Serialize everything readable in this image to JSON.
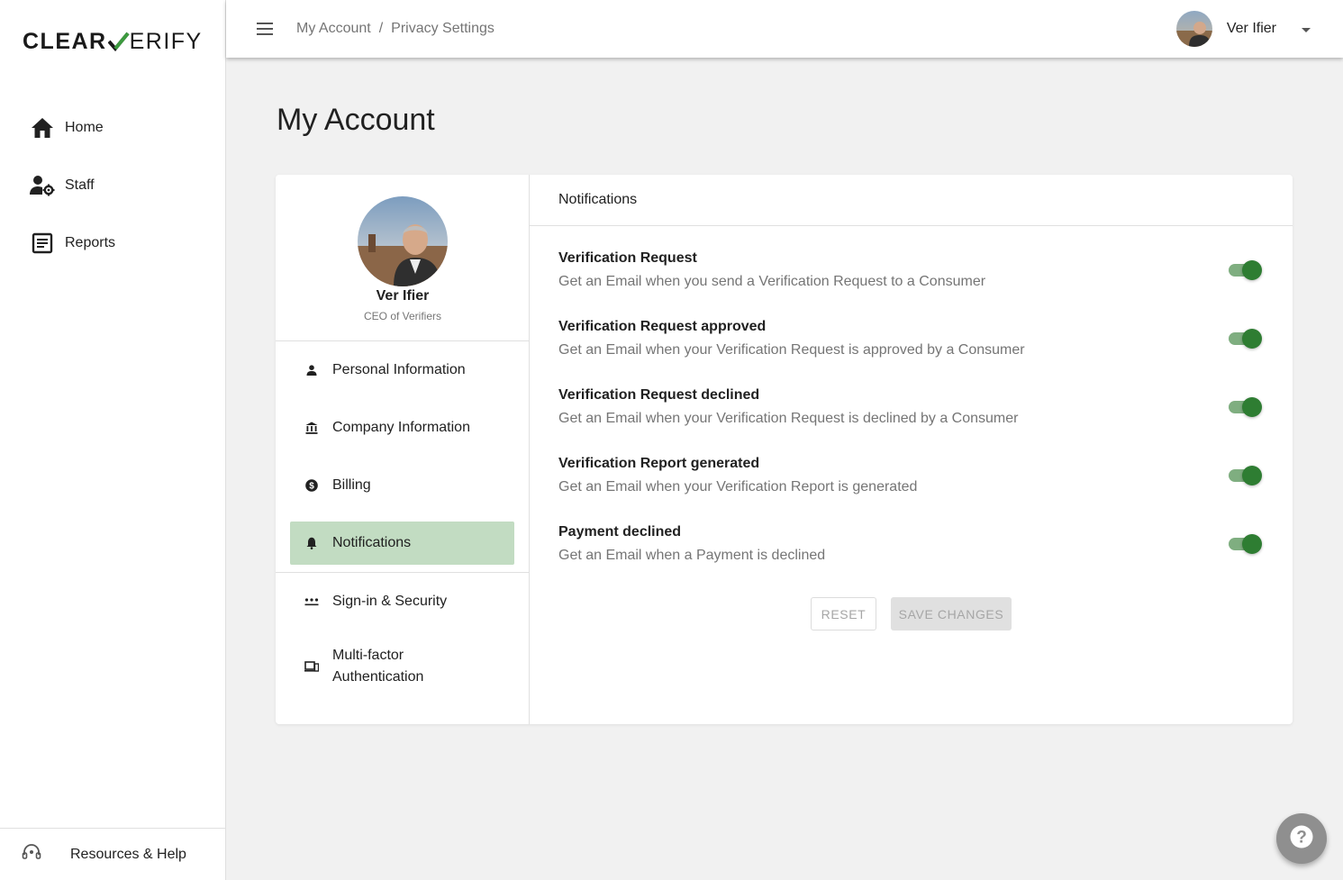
{
  "brand": {
    "part1": "CLEAR",
    "part2": "ERIFY",
    "accent": "#2e7d32"
  },
  "sidebar": {
    "items": [
      {
        "label": "Home",
        "icon": "home-icon"
      },
      {
        "label": "Staff",
        "icon": "staff-gear-icon"
      },
      {
        "label": "Reports",
        "icon": "report-icon"
      }
    ],
    "footer_label": "Resources & Help"
  },
  "header": {
    "breadcrumb": [
      "My Account",
      "Privacy Settings"
    ],
    "user_name": "Ver Ifier"
  },
  "page_title": "My Account",
  "profile": {
    "name": "Ver Ifier",
    "title": "CEO of Verifiers"
  },
  "account_nav": [
    {
      "label": "Personal Information",
      "icon": "person-icon"
    },
    {
      "label": "Company Information",
      "icon": "bank-icon"
    },
    {
      "label": "Billing",
      "icon": "dollar-icon"
    },
    {
      "label": "Notifications",
      "icon": "bell-icon",
      "active": true
    },
    {
      "label": "Sign-in & Security",
      "icon": "password-icon"
    },
    {
      "label": "Multi-factor Authentication",
      "icon": "devices-icon"
    }
  ],
  "panel": {
    "title": "Notifications",
    "items": [
      {
        "title": "Verification Request",
        "desc": "Get an Email when you send a Verification Request to a Consumer",
        "enabled": true
      },
      {
        "title": "Verification Request approved",
        "desc": "Get an Email when your Verification Request is approved by a Consumer",
        "enabled": true
      },
      {
        "title": "Verification Request declined",
        "desc": "Get an Email when your Verification Request is declined by a Consumer",
        "enabled": true
      },
      {
        "title": "Verification Report generated",
        "desc": "Get an Email when your Verification Report is generated",
        "enabled": true
      },
      {
        "title": "Payment declined",
        "desc": "Get an Email when a Payment is declined",
        "enabled": true
      }
    ],
    "reset_label": "RESET",
    "save_label": "SAVE CHANGES"
  },
  "help_fab_icon": "question-icon"
}
